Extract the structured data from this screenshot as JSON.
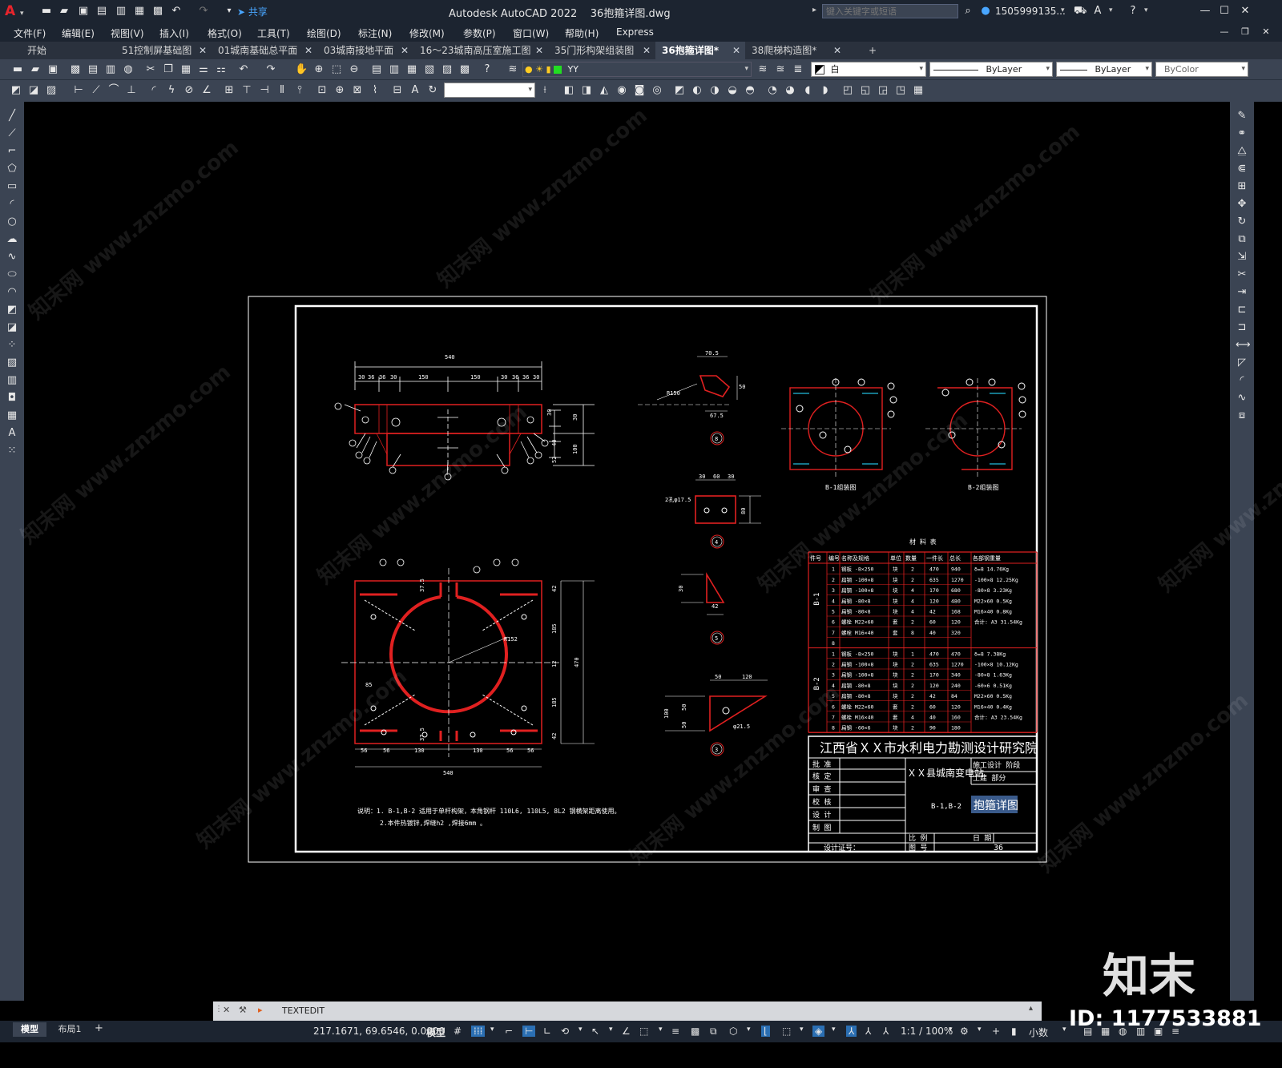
{
  "titlebar": {
    "app_logo": "A",
    "share_label": "共享",
    "title": "Autodesk AutoCAD 2022    36抱箍详图.dwg",
    "search_placeholder": "键入关键字或短语",
    "user": "1505999135...",
    "icons": [
      "new-icon",
      "open-icon",
      "save-icon",
      "saveas-icon",
      "plot-icon",
      "undo-icon",
      "redo-icon",
      "share-icon",
      "search-icon",
      "user-icon",
      "cart-icon",
      "help-icon",
      "minimize-icon",
      "maximize-icon",
      "close-icon"
    ]
  },
  "menubar": {
    "items": [
      "文件(F)",
      "编辑(E)",
      "视图(V)",
      "插入(I)",
      "格式(O)",
      "工具(T)",
      "绘图(D)",
      "标注(N)",
      "修改(M)",
      "参数(P)",
      "窗口(W)",
      "帮助(H)",
      "Express"
    ]
  },
  "tabs": [
    {
      "label": "开始",
      "active": false,
      "closable": false
    },
    {
      "label": "51控制屏基础图",
      "active": false,
      "closable": true
    },
    {
      "label": "01城南基础总平面",
      "active": false,
      "closable": true
    },
    {
      "label": "03城南接地平面",
      "active": false,
      "closable": true
    },
    {
      "label": "16～23城南高压室施工图",
      "active": false,
      "closable": true
    },
    {
      "label": "35门形构架组装图",
      "active": false,
      "closable": true
    },
    {
      "label": "36抱箍详图*",
      "active": true,
      "closable": true
    },
    {
      "label": "38爬梯构造图*",
      "active": false,
      "closable": true
    }
  ],
  "add_tab": "+",
  "toolbar": {
    "layer": "YY",
    "color": "白",
    "linetype": "ByLayer",
    "lineweight": "ByLayer",
    "plotstyle": "ByColor",
    "layer_color": "#22dd22"
  },
  "command": {
    "prompt": "TEXTEDIT"
  },
  "status": {
    "tab_model": "模型",
    "tab_layout": "布局1",
    "add_layout": "+",
    "coords": "217.1671, 69.6546, 0.0000",
    "model_label": "模型",
    "scale": "1:1 / 100%",
    "units": "小数"
  },
  "overlay": {
    "brand": "知末",
    "id_label": "ID: 1177533881",
    "watermark": "知末网 www.znzmo.com"
  },
  "drawing": {
    "top_view": {
      "overall": "540",
      "dims": [
        "30",
        "36",
        "36",
        "30",
        "150",
        "150",
        "30",
        "36",
        "36",
        "30"
      ],
      "side_dims": [
        "30",
        "30",
        "40",
        "52",
        "100"
      ],
      "balloons": [
        "1",
        "2",
        "3",
        "4",
        "6"
      ]
    },
    "plan_view": {
      "dims_right": [
        "42",
        "185",
        "470",
        "185",
        "42"
      ],
      "dims_bottom": [
        "56",
        "56",
        "130",
        "130",
        "56",
        "56"
      ],
      "overall": "540",
      "radius": "R152",
      "small": [
        "17.5",
        "85",
        "37.5",
        "12",
        "8"
      ]
    },
    "part8": {
      "dims": [
        "70.5",
        "67.5",
        "50"
      ],
      "radius": "R150",
      "balloon": "8"
    },
    "part4": {
      "dims": [
        "30",
        "60",
        "30",
        "80"
      ],
      "hole": "2孔φ17.5",
      "balloon": "4"
    },
    "part5": {
      "dims": [
        "30",
        "42"
      ],
      "balloon": "5"
    },
    "part3": {
      "dims": [
        "50",
        "120",
        "100",
        "50",
        "50"
      ],
      "hole": "φ21.5",
      "balloon": "3"
    },
    "b1_label": "B-1组装图",
    "b2_label": "B-2组装图",
    "notes": [
      "说明：1. B-1,B-2 适用于单杆构架，本角钢杆 110L6, 110L5, 8L2     钢横架距离使用。",
      "2.本件热镀锌,焊缝h2  ,焊接6mm    。"
    ],
    "material_table": {
      "title": "材 料 表",
      "headers": [
        "件号",
        "编号",
        "名称及规格",
        "单位",
        "数量",
        "一件长",
        "总长",
        "各部钢重量"
      ],
      "groups": [
        {
          "label": "B-1",
          "rows": [
            [
              "1",
              "钢板 -8×250",
              "块",
              "2",
              "470",
              "940",
              "δ=8    14.76Kg"
            ],
            [
              "2",
              "扁钢 -100×8",
              "块",
              "2",
              "635",
              "1270",
              "-100×8  12.25Kg"
            ],
            [
              "3",
              "扁钢 -100×8",
              "块",
              "4",
              "170",
              "680",
              "-80×8   3.23Kg"
            ],
            [
              "4",
              "扁钢 -80×8",
              "块",
              "4",
              "120",
              "480",
              "M22×60   0.5Kg"
            ],
            [
              "5",
              "扁钢 -80×8",
              "块",
              "4",
              "42",
              "168",
              "M16×40   0.8Kg"
            ],
            [
              "6",
              "螺栓 M22×60",
              "套",
              "2",
              "60",
              "120",
              "合计: A3  31.54Kg"
            ],
            [
              "7",
              "螺栓 M16×40",
              "套",
              "8",
              "40",
              "320",
              ""
            ],
            [
              "8",
              "",
              "",
              "",
              "",
              "",
              ""
            ]
          ]
        },
        {
          "label": "B-2",
          "rows": [
            [
              "1",
              "钢板 -8×250",
              "块",
              "1",
              "470",
              "470",
              "δ=8     7.38Kg"
            ],
            [
              "2",
              "扁钢 -100×8",
              "块",
              "2",
              "635",
              "1270",
              "-100×8  10.12Kg"
            ],
            [
              "3",
              "扁钢 -100×8",
              "块",
              "2",
              "170",
              "340",
              "-80×8   1.63Kg"
            ],
            [
              "4",
              "扁钢 -80×8",
              "块",
              "2",
              "120",
              "240",
              "-60×6   0.51Kg"
            ],
            [
              "5",
              "扁钢 -80×8",
              "块",
              "2",
              "42",
              "84",
              "M22×60   0.5Kg"
            ],
            [
              "6",
              "螺栓 M22×60",
              "套",
              "2",
              "60",
              "120",
              "M16×40   0.4Kg"
            ],
            [
              "7",
              "螺栓 M16×40",
              "套",
              "4",
              "40",
              "160",
              "合计: A3  23.54Kg"
            ],
            [
              "8",
              "扁钢 -60×6",
              "块",
              "2",
              "90",
              "180",
              ""
            ]
          ]
        }
      ]
    },
    "titleblock": {
      "institute": "江西省ＸＸ市水利电力勘测设计研究院",
      "project": "ＸＸ县城南变电站",
      "stage_label": "施工设计  阶段",
      "part_label": "土建       部分",
      "rows": [
        "批 准",
        "核 定",
        "审 查",
        "校 核",
        "设 计",
        "制 图"
      ],
      "drawing_code": "B-1,B-2",
      "drawing_name": "抱箍详图",
      "scale_label": "比 例",
      "date_label": "日 期",
      "no_label": "图 号",
      "no_value": "36",
      "cert_label": "设计证号："
    }
  }
}
